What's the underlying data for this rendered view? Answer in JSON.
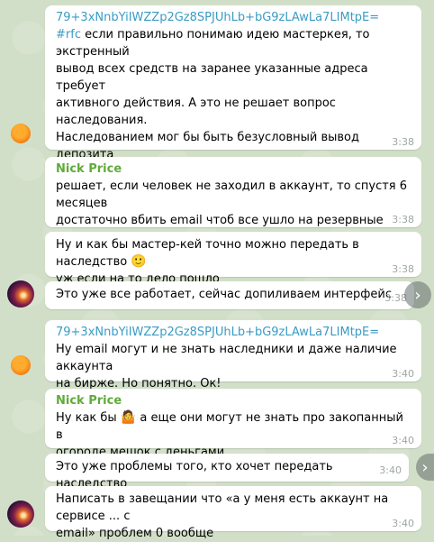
{
  "messages": [
    {
      "sender": "79+3xNnbYiIWZZp2Gz8SPJUhLb+bG9zLAwLa7LIMtpE=",
      "tag": "#rfc",
      "text": " если правильно понимаю идею мастеркея, то экстренный\nвывод всех средств на заранее указанные адреса требует\nактивного действия. А это не решает вопрос наследования.\nНаследованием мог бы быть безусловный вывод депозита\nчерез указанный в настройках период времени, после\nотсутствия активности аккаунта, ну с какими-то ещё\nограничениями.",
      "time": "3:38"
    },
    {
      "sender": "Nick Price",
      "text": "решает, если человек не заходил в аккаунт, то спустя 6 месяцев\nдостаточно вбить email чтоб все ушло на резервные адреса",
      "time": "3:38"
    },
    {
      "text": "Ну и как бы мастер-кей точно можно передать в наследство",
      "emoji": "🙂",
      "text2": "уж если на то дело пошло",
      "time": "3:38"
    },
    {
      "text": "Это уже все работает, сейчас допиливаем интерфейс",
      "time": "3:38"
    },
    {
      "sender": "79+3xNnbYiIWZZp2Gz8SPJUhLb+bG9zLAwLa7LIMtpE=",
      "text": "Ну email могут и не знать наследники и даже наличие аккаунта\nна бирже. Но понятно. Ок!",
      "time": "3:40"
    },
    {
      "sender": "Nick Price",
      "text_a": "Ну как бы",
      "emoji": "🤷",
      "text_b": " а еще они могут не знать про закопанный в",
      "text2": "огороде мешок с деньгами",
      "time": "3:40"
    },
    {
      "text": "Это уже проблемы того, кто хочет передать наследство",
      "time": "3:40"
    },
    {
      "text": "Написать в завещании что «а у меня есть аккаунт на сервисе ... с\nemail» проблем 0 вообще",
      "time": "3:40"
    }
  ],
  "icons": {
    "forward": "forward-arrow-icon",
    "avatar_orange": "orange-circle-avatar",
    "avatar_nebula": "nebula-avatar"
  },
  "colors": {
    "hash_sender": "#3a9cc4",
    "nick_sender": "#5fab3a",
    "bubble": "#ffffff",
    "background": "#d2dfc8"
  }
}
